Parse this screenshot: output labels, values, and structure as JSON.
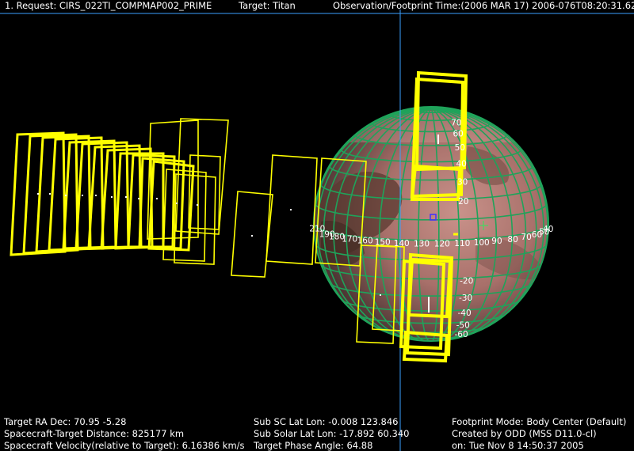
{
  "header": {
    "request": "1. Request:  CIRS_022TI_COMPMAP002_PRIME",
    "target": "Target: Titan",
    "observation_time": "Observation/Footprint Time:(2006 MAR 17)  2006-076T08:20:31.62"
  },
  "globe_labels": {
    "longitude": [
      "210",
      "190",
      "180",
      "170",
      "160",
      "150",
      "140",
      "130",
      "120",
      "110",
      "100",
      "90",
      "80",
      "70",
      "60",
      "50",
      "40"
    ],
    "latitude_north": [
      "70",
      "60",
      "50",
      "40",
      "30",
      "20"
    ],
    "latitude_south": [
      "-20",
      "-30",
      "-40",
      "-50",
      "-60"
    ]
  },
  "footer": {
    "target_ra_dec": "Target RA  Dec: 70.95   -5.28",
    "distance": "Spacecraft-Target Distance:   825177 km",
    "velocity": "Spacecraft Velocity(relative to Target): 6.16386 km/s",
    "sub_sc": "Sub SC Lat Lon:  -0.008   123.846",
    "sub_solar": "Sub Solar Lat Lon:  -17.892   60.340",
    "phase_angle": "Target Phase Angle:  64.88",
    "footprint_mode": "Footprint Mode: Body Center (Default)",
    "created_by": "Created by ODD (MSS D11.0-cl)",
    "created_on": "on: Tue Nov  8 14:50:37 2005"
  },
  "colors": {
    "footprint": "#ffff00",
    "grid": "#1fa35a",
    "crosshair": "#3aa0ff",
    "globe_base": "#8a5a50",
    "marker": "#4030ff"
  }
}
